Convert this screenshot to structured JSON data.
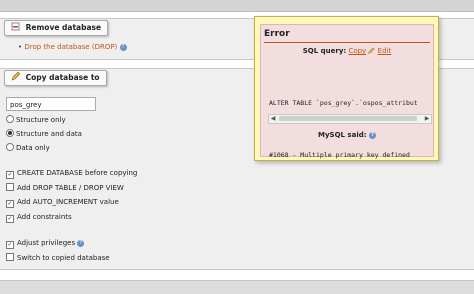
{
  "remove_section": {
    "legend": "Remove database",
    "drop_link": "Drop the database (DROP)"
  },
  "copy_section": {
    "legend": "Copy database to",
    "db_name_value": "pos_grey",
    "radio_options": [
      "Structure only",
      "Structure and data",
      "Data only"
    ],
    "selected_radio": "Structure and data",
    "checkboxes": [
      {
        "label": "CREATE DATABASE before copying",
        "checked": true
      },
      {
        "label": "Add DROP TABLE / DROP VIEW",
        "checked": false
      },
      {
        "label": "Add AUTO_INCREMENT value",
        "checked": true
      },
      {
        "label": "Add constraints",
        "checked": true
      },
      {
        "label": "Adjust privileges",
        "checked": true
      },
      {
        "label": "Switch to copied database",
        "checked": false
      }
    ]
  },
  "error_popup": {
    "title": "Error",
    "sql_query_label": "SQL query:",
    "copy_link": "Copy",
    "edit_link": "Edit",
    "query_text": "ALTER TABLE `pos_grey`.`ospos_attribut",
    "mysql_said": "MySQL said:",
    "error_text": "#1068 - Multiple primary key defined"
  },
  "icons": {
    "legend_remove": "remove-db-icon",
    "legend_copy": "copy-db-icon",
    "help": "help-icon",
    "edit": "pencil-icon"
  },
  "colors": {
    "link": "#c2541b",
    "error_bg": "#f2dede",
    "popup_bg": "#fff8b8"
  }
}
